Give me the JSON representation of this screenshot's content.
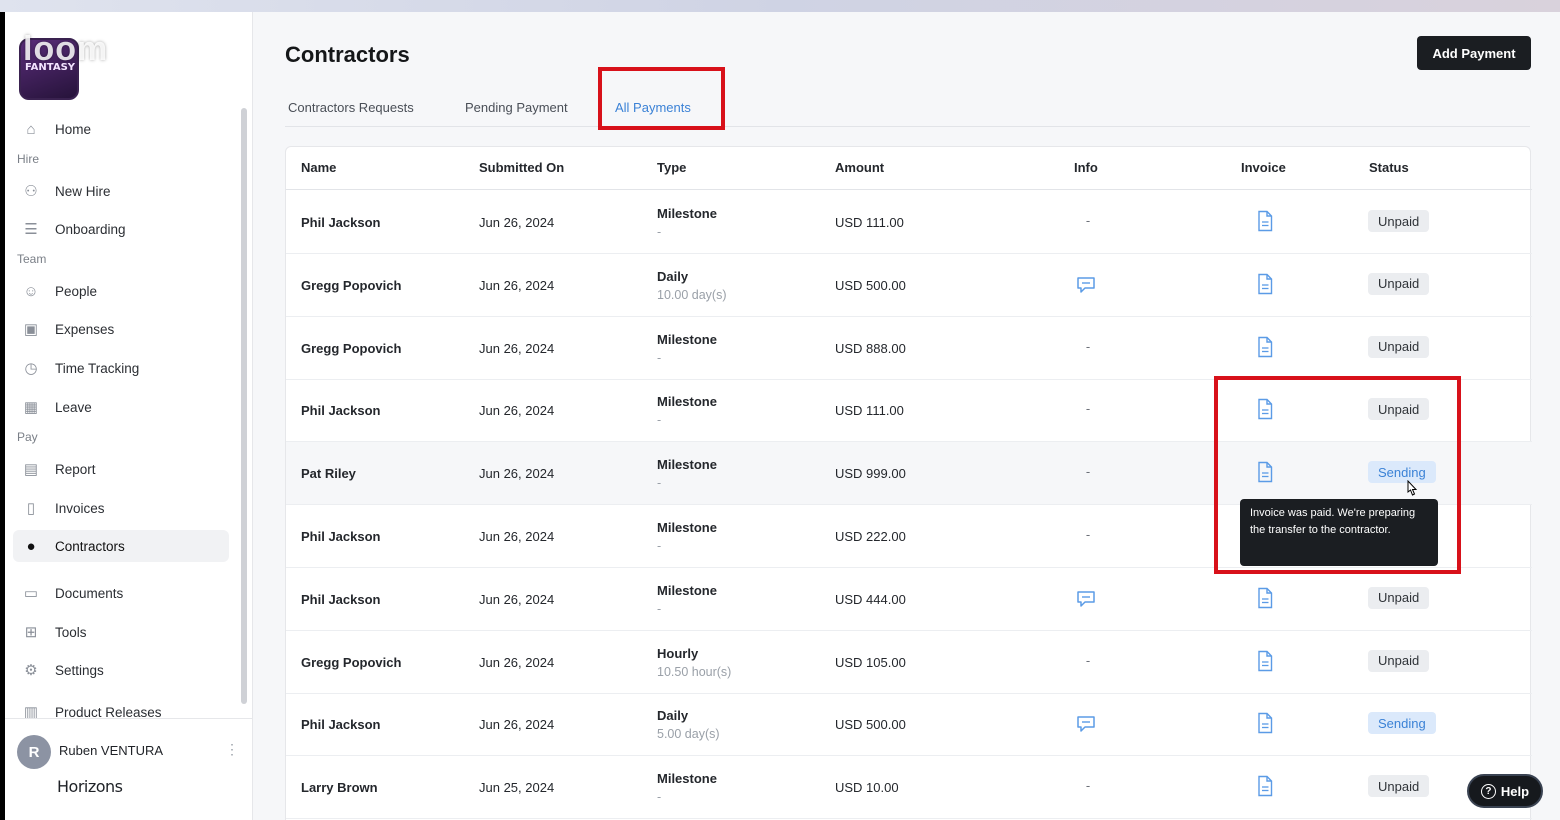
{
  "brand": {
    "logo_text": "FANTASY",
    "recorder_text": "loom"
  },
  "sidebar": {
    "items": [
      {
        "label": "Home",
        "icon": "home-icon"
      },
      {
        "label": "New Hire",
        "icon": "add-user-icon"
      },
      {
        "label": "Onboarding",
        "icon": "list-icon"
      },
      {
        "label": "People",
        "icon": "people-icon"
      },
      {
        "label": "Expenses",
        "icon": "expense-icon"
      },
      {
        "label": "Time Tracking",
        "icon": "clock-icon"
      },
      {
        "label": "Leave",
        "icon": "calendar-icon"
      },
      {
        "label": "Report",
        "icon": "report-icon"
      },
      {
        "label": "Invoices",
        "icon": "invoice-icon"
      },
      {
        "label": "Contractors",
        "icon": "contractors-icon"
      },
      {
        "label": "Documents",
        "icon": "document-icon"
      },
      {
        "label": "Tools",
        "icon": "tools-icon"
      },
      {
        "label": "Settings",
        "icon": "gear-icon"
      },
      {
        "label": "Product Releases",
        "icon": "releases-icon"
      }
    ],
    "sections": [
      "Hire",
      "Team",
      "Pay"
    ],
    "user": {
      "initial": "R",
      "name": "Ruben VENTURA",
      "company": "Horizons"
    }
  },
  "header": {
    "title": "Contractors",
    "add_button": "Add Payment"
  },
  "tabs": [
    "Contractors Requests",
    "Pending Payment",
    "All Payments"
  ],
  "table": {
    "columns": [
      "Name",
      "Submitted On",
      "Type",
      "Amount",
      "Info",
      "Invoice",
      "Status"
    ],
    "rows": [
      {
        "name": "Phil Jackson",
        "date": "Jun 26, 2024",
        "type": "Milestone",
        "sub": "-",
        "amount": "USD 111.00",
        "info": "-",
        "status": "Unpaid"
      },
      {
        "name": "Gregg Popovich",
        "date": "Jun 26, 2024",
        "type": "Daily",
        "sub": "10.00 day(s)",
        "amount": "USD 500.00",
        "info": "",
        "status": "Unpaid"
      },
      {
        "name": "Gregg Popovich",
        "date": "Jun 26, 2024",
        "type": "Milestone",
        "sub": "-",
        "amount": "USD 888.00",
        "info": "-",
        "status": "Unpaid"
      },
      {
        "name": "Phil Jackson",
        "date": "Jun 26, 2024",
        "type": "Milestone",
        "sub": "-",
        "amount": "USD 111.00",
        "info": "-",
        "status": "Unpaid"
      },
      {
        "name": "Pat Riley",
        "date": "Jun 26, 2024",
        "type": "Milestone",
        "sub": "-",
        "amount": "USD 999.00",
        "info": "-",
        "status": "Sending"
      },
      {
        "name": "Phil Jackson",
        "date": "Jun 26, 2024",
        "type": "Milestone",
        "sub": "-",
        "amount": "USD 222.00",
        "info": "-",
        "status": ""
      },
      {
        "name": "Phil Jackson",
        "date": "Jun 26, 2024",
        "type": "Milestone",
        "sub": "-",
        "amount": "USD 444.00",
        "info": "",
        "status": "Unpaid"
      },
      {
        "name": "Gregg Popovich",
        "date": "Jun 26, 2024",
        "type": "Hourly",
        "sub": "10.50 hour(s)",
        "amount": "USD 105.00",
        "info": "-",
        "status": "Unpaid"
      },
      {
        "name": "Phil Jackson",
        "date": "Jun 26, 2024",
        "type": "Daily",
        "sub": "5.00 day(s)",
        "amount": "USD 500.00",
        "info": "",
        "status": "Sending"
      },
      {
        "name": "Larry Brown",
        "date": "Jun 25, 2024",
        "type": "Milestone",
        "sub": "-",
        "amount": "USD 10.00",
        "info": "-",
        "status": "Unpaid"
      }
    ]
  },
  "tooltip": {
    "text": "Invoice was paid. We're preparing the transfer to the contractor."
  },
  "help_button": "Help",
  "colors": {
    "accent": "#3b82d6",
    "annotation": "#d8111a",
    "primary_button": "#1b1e22"
  }
}
